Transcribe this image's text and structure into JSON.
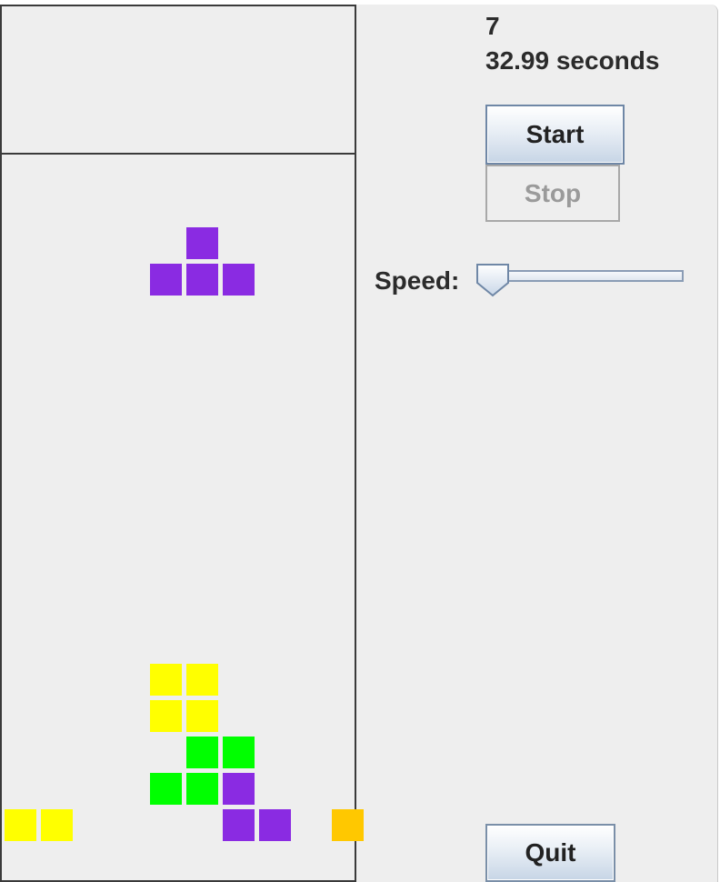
{
  "score": "7",
  "elapsed_time": "32.99 seconds",
  "buttons": {
    "start": "Start",
    "stop": "Stop",
    "quit": "Quit"
  },
  "speed": {
    "label": "Speed:",
    "value_fraction": 0.0
  },
  "colors": {
    "purple": "#8a2be2",
    "yellow": "#ffff00",
    "green": "#00ff00",
    "orange": "#ffc800",
    "board_border": "#3a3a3a"
  },
  "board": {
    "columns": 10,
    "falling_piece": {
      "shape": "T",
      "color": "purple",
      "cells": [
        [
          5,
          7
        ],
        [
          4,
          8
        ],
        [
          5,
          8
        ],
        [
          6,
          8
        ]
      ]
    },
    "settled_cells": [
      {
        "col": 4,
        "row": 19,
        "color": "yellow"
      },
      {
        "col": 5,
        "row": 19,
        "color": "yellow"
      },
      {
        "col": 4,
        "row": 20,
        "color": "yellow"
      },
      {
        "col": 5,
        "row": 20,
        "color": "yellow"
      },
      {
        "col": 5,
        "row": 21,
        "color": "green"
      },
      {
        "col": 6,
        "row": 21,
        "color": "green"
      },
      {
        "col": 4,
        "row": 22,
        "color": "green"
      },
      {
        "col": 5,
        "row": 22,
        "color": "green"
      },
      {
        "col": 6,
        "row": 22,
        "color": "purple"
      },
      {
        "col": 0,
        "row": 23,
        "color": "yellow"
      },
      {
        "col": 1,
        "row": 23,
        "color": "yellow"
      },
      {
        "col": 6,
        "row": 23,
        "color": "purple"
      },
      {
        "col": 7,
        "row": 23,
        "color": "purple"
      },
      {
        "col": 9,
        "row": 23,
        "color": "orange"
      }
    ]
  }
}
